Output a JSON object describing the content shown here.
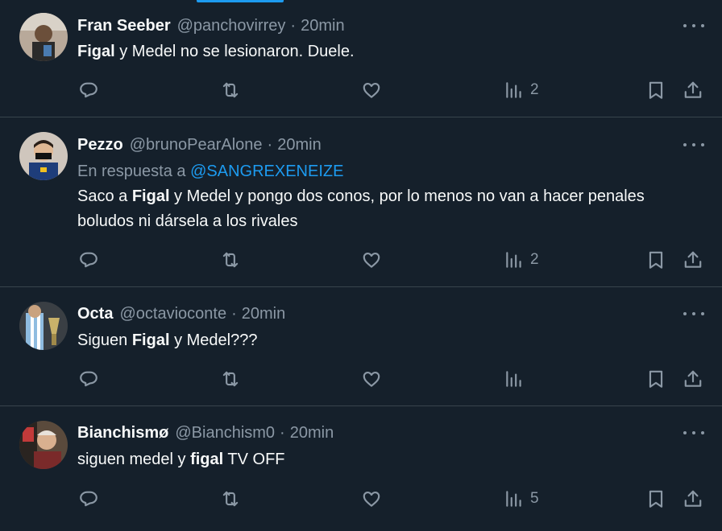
{
  "tweets": [
    {
      "name": "Fran Seeber",
      "handle": "@panchovirrey",
      "separator": "·",
      "time": "20min",
      "reply_prefix": "",
      "reply_to": "",
      "text_parts": [
        "",
        "Figal",
        " y Medel no se lesionaron. Duele."
      ],
      "views": "2"
    },
    {
      "name": "Pezzo",
      "handle": "@brunoPearAlone",
      "separator": "·",
      "time": "20min",
      "reply_prefix": "En respuesta a ",
      "reply_to": "@SANGREXENEIZE",
      "text_parts": [
        "Saco a ",
        "Figal",
        " y Medel y pongo dos conos, por lo menos no van a hacer penales boludos ni dársela a los rivales"
      ],
      "views": "2"
    },
    {
      "name": "Octa",
      "handle": "@octavioconte",
      "separator": "·",
      "time": "20min",
      "reply_prefix": "",
      "reply_to": "",
      "text_parts": [
        "Siguen ",
        "Figal",
        " y Medel???"
      ],
      "views": ""
    },
    {
      "name": "Bianchismø",
      "handle": "@Bianchism0",
      "separator": "·",
      "time": "20min",
      "reply_prefix": "",
      "reply_to": "",
      "text_parts": [
        "siguen medel y ",
        "figal",
        " TV OFF"
      ],
      "views": "5"
    }
  ],
  "icons": {
    "reply": "reply-icon",
    "retweet": "retweet-icon",
    "like": "heart-icon",
    "views": "views-chart-icon",
    "bookmark": "bookmark-icon",
    "share": "share-icon",
    "more": "more-icon"
  },
  "colors": {
    "background": "#15202b",
    "text": "#f7f9f9",
    "muted": "#8b98a5",
    "accent": "#1d9bf0",
    "divider": "#38444d"
  }
}
